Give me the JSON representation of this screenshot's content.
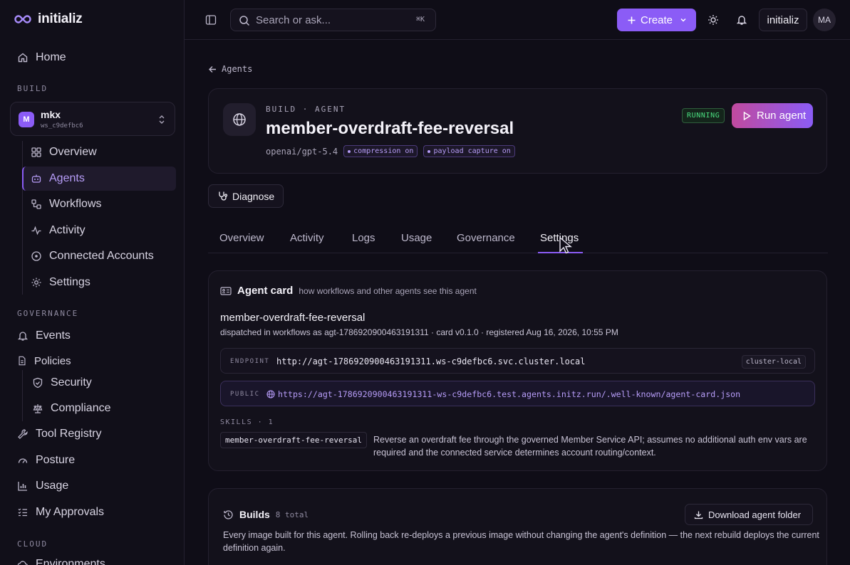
{
  "app": {
    "name": "initializ"
  },
  "sidebar": {
    "home": "Home",
    "build_label": "BUILD",
    "workspace": {
      "initial": "M",
      "name": "mkx",
      "id": "ws_c9defbc6"
    },
    "build_items": [
      {
        "label": "Overview",
        "icon": "grid-icon"
      },
      {
        "label": "Agents",
        "icon": "bot-icon"
      },
      {
        "label": "Workflows",
        "icon": "workflow-icon"
      },
      {
        "label": "Activity",
        "icon": "activity-icon"
      },
      {
        "label": "Connected Accounts",
        "icon": "plug-icon"
      },
      {
        "label": "Settings",
        "icon": "gear-icon"
      }
    ],
    "governance_label": "GOVERNANCE",
    "events": "Events",
    "policies": "Policies",
    "policy_items": [
      {
        "label": "Security",
        "icon": "shield-icon"
      },
      {
        "label": "Compliance",
        "icon": "scale-icon"
      }
    ],
    "tool_registry": "Tool Registry",
    "posture": "Posture",
    "usage": "Usage",
    "approvals": "My Approvals",
    "cloud_label": "CLOUD",
    "environments": "Environments"
  },
  "topbar": {
    "search_placeholder": "Search or ask...",
    "search_shortcut": "⌘K",
    "create_label": "Create",
    "org_label": "initializ",
    "user_initials": "MA"
  },
  "breadcrumb": {
    "back_label": "Agents"
  },
  "agent": {
    "eyebrow": "BUILD · AGENT",
    "name": "member-overdraft-fee-reversal",
    "model": "openai/gpt-5.4",
    "pills": [
      "compression on",
      "payload capture on"
    ],
    "status": "RUNNING",
    "run_label": "Run agent",
    "diagnose_label": "Diagnose"
  },
  "tabs": [
    "Overview",
    "Activity",
    "Logs",
    "Usage",
    "Governance",
    "Settings"
  ],
  "active_tab": "Settings",
  "agent_card": {
    "title": "Agent card",
    "subtitle": "how workflows and other agents see this agent",
    "name": "member-overdraft-fee-reversal",
    "description": "dispatched in workflows as agt-1786920900463191311 · card v0.1.0 · registered Aug 16, 2026, 10:55 PM",
    "endpoint_label": "ENDPOINT",
    "endpoint_value": "http://agt-1786920900463191311.ws-c9defbc6.svc.cluster.local",
    "endpoint_tag": "cluster-local",
    "public_label": "PUBLIC",
    "public_value": "https://agt-1786920900463191311-ws-c9defbc6.test.agents.initz.run/.well-known/agent-card.json",
    "skills_label": "SKILLS · 1",
    "skill_name": "member-overdraft-fee-reversal",
    "skill_desc": "Reverse an overdraft fee through the governed Member Service API; assumes no additional auth env vars are required and the connected service determines account routing/context."
  },
  "builds": {
    "title": "Builds",
    "count": "8 total",
    "download_label": "Download agent folder",
    "description": "Every image built for this agent. Rolling back re-deploys a previous image without changing the agent's definition — the next rebuild deploys the current definition again."
  },
  "colors": {
    "accent": "#8b5cf6",
    "running": "#4ade80",
    "background": "#0f0d17"
  }
}
